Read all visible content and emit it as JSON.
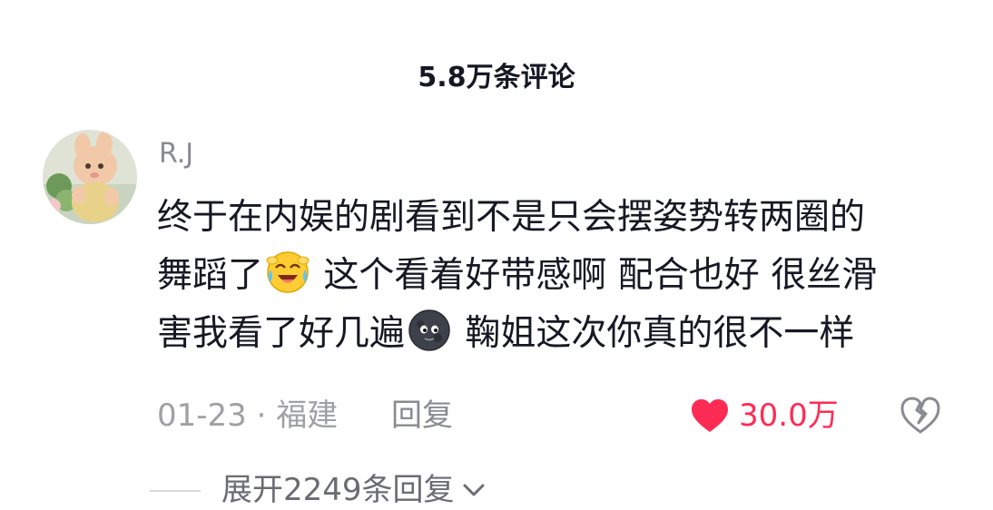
{
  "header": {
    "title": "5.8万条评论"
  },
  "comment": {
    "username": "R.J",
    "avatar_icon": "avatar-image",
    "text_line1": "终于在内娱的剧看到不是只会摆姿势转两圈的",
    "text_line2_a": "舞蹈了",
    "text_line2_emoji": "laughing-crying-emoji",
    "text_line2_b": " 这个看着好带感啊 配合也好 很丝滑",
    "text_line3_a": "害我看了好几遍",
    "text_line3_emoji": "dark-moon-face-emoji",
    "text_line3_b": " 鞠姐这次你真的很不一样",
    "date": "01-23",
    "separator": "·",
    "location": "福建",
    "reply_label": "回复",
    "like_count": "30.0万",
    "like_icon": "heart-icon",
    "dislike_icon": "broken-heart-icon",
    "like_color": "#fe2c55"
  },
  "replies": {
    "expand_label": "展开2249条回复",
    "expand_icon": "chevron-down-icon"
  }
}
